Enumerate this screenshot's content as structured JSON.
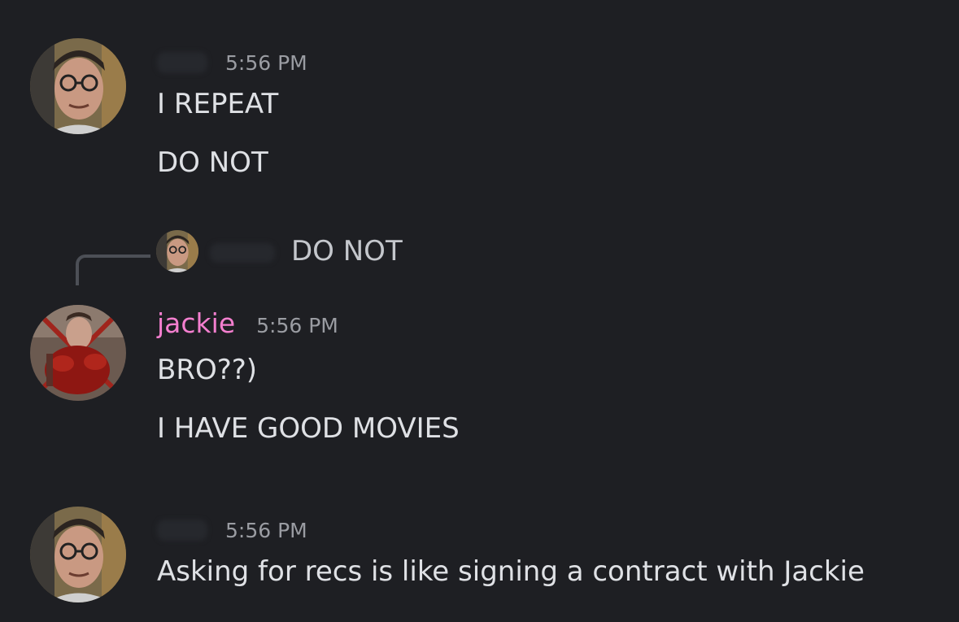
{
  "messages": [
    {
      "author": "",
      "timestamp": "5:56 PM",
      "avatar_icon": "man-with-glasses-avatar",
      "lines": [
        "I REPEAT",
        "DO NOT"
      ]
    },
    {
      "reply_to": {
        "author": "",
        "text": "DO NOT",
        "avatar_icon": "man-with-glasses-avatar"
      },
      "author": "jackie",
      "author_color": "#f47fcf",
      "timestamp": "5:56 PM",
      "avatar_icon": "bloody-figure-avatar",
      "lines": [
        "BRO??)",
        "I HAVE GOOD MOVIES"
      ]
    },
    {
      "author": "",
      "timestamp": "5:56 PM",
      "avatar_icon": "man-with-glasses-avatar",
      "lines": [
        "Asking for recs is like signing a contract with Jackie"
      ]
    }
  ],
  "colors": {
    "background": "#1e1f23",
    "text": "#dfe1e5",
    "timestamp": "#9a9ca2",
    "reply_line": "#4c4f56"
  }
}
